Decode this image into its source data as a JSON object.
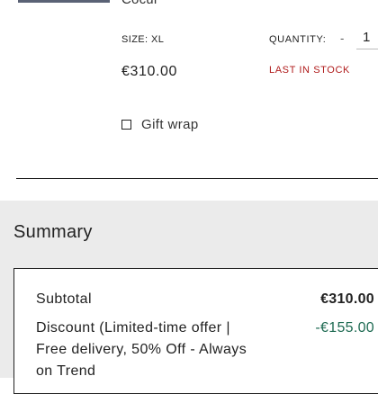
{
  "product": {
    "title": "Cocur",
    "size_label": "SIZE: XL",
    "quantity_label": "QUANTITY:",
    "quantity_decrement": "-",
    "quantity_value": "1",
    "price": "€310.00",
    "stock_status": "LAST IN STOCK",
    "gift_wrap_label": "Gift wrap",
    "gift_wrap_checked": false
  },
  "summary": {
    "title": "Summary",
    "subtotal_label": "Subtotal",
    "subtotal_value": "€310.00",
    "discount_label": "Discount (Limited-time offer | Free delivery, 50% Off - Always on Trend",
    "discount_value": "-€155.00"
  },
  "colors": {
    "stock_status": "#b01c1c",
    "discount": "#1f6b53",
    "summary_background": "#ebebeb"
  }
}
